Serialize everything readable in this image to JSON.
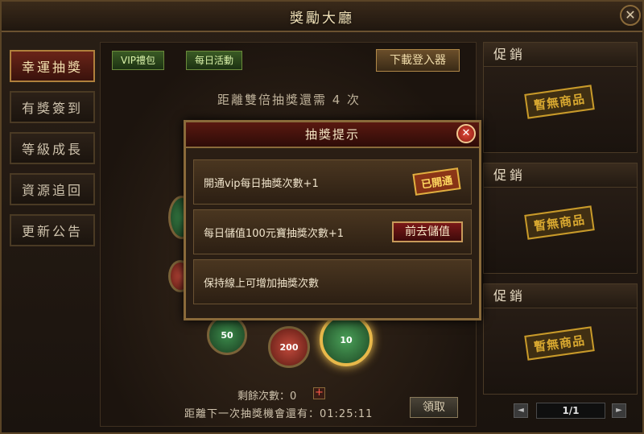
{
  "window": {
    "title": "獎勵大廳",
    "close_icon": "✕"
  },
  "sidebar": {
    "items": [
      {
        "label": "幸運抽獎",
        "active": true
      },
      {
        "label": "有獎簽到",
        "active": false
      },
      {
        "label": "等級成長",
        "active": false
      },
      {
        "label": "資源追回",
        "active": false
      },
      {
        "label": "更新公告",
        "active": false
      }
    ]
  },
  "main": {
    "tabs": [
      {
        "label": "VIP禮包"
      },
      {
        "label": "每日活動"
      }
    ],
    "download_label": "下載登入器",
    "double_text": "距離雙倍抽獎還需 4 次",
    "coins": [
      "50",
      "200",
      "10"
    ],
    "remaining_text": "剩餘次數：0",
    "plus_label": "+",
    "next_chance_text": "距離下一次抽獎機會還有：01:25:11",
    "claim_label": "領取"
  },
  "promo": {
    "blocks": [
      {
        "title": "促銷",
        "stamp": "暫無商品"
      },
      {
        "title": "促銷",
        "stamp": "暫無商品"
      },
      {
        "title": "促銷",
        "stamp": "暫無商品"
      }
    ],
    "pager": {
      "prev": "◄",
      "page": "1/1",
      "next": "►"
    }
  },
  "dialog": {
    "title": "抽獎提示",
    "close_icon": "✕",
    "rows": [
      {
        "text": "開通vip每日抽獎次數+1",
        "stamp": "已開通"
      },
      {
        "text": "每日儲值100元寶抽獎次數+1",
        "button": "前去儲值"
      },
      {
        "text": "保持線上可增加抽獎次數"
      }
    ]
  },
  "colors": {
    "accent_gold": "#b0803c",
    "active_red": "#6a2418",
    "vip_green": "#3a5a24"
  }
}
